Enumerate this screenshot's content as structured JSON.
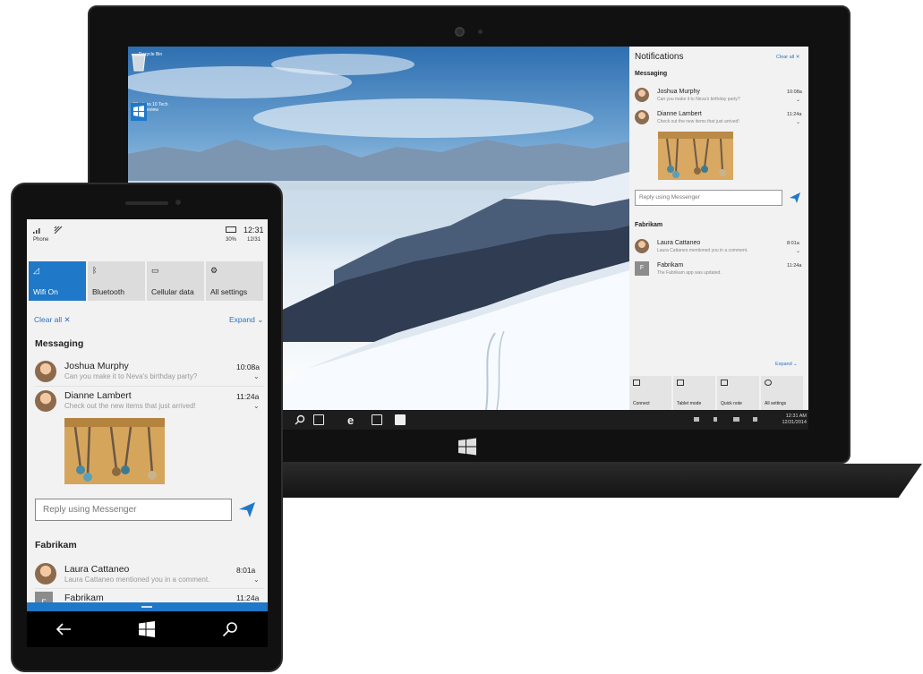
{
  "laptop": {
    "desktop_icons": [
      {
        "label": "Recycle Bin",
        "icon": "recycle-bin-icon"
      },
      {
        "label": "Windows 10 Tech Preview",
        "icon": "windows-logo-icon"
      }
    ],
    "notifications": {
      "title": "Notifications",
      "clear_all": "Clear all ✕",
      "expand": "Expand ⌄",
      "sections": [
        {
          "title": "Messaging",
          "items": [
            {
              "name": "Joshua Murphy",
              "message": "Can you make it to Neva's birthday party?",
              "time": "10:08a"
            },
            {
              "name": "Dianne Lambert",
              "message": "Check out the new items that just arrived!",
              "time": "11:24a"
            }
          ]
        },
        {
          "title": "Fabrikam",
          "items": [
            {
              "name": "Laura Cattaneo",
              "message": "Laura Cattaneo mentioned you in a comment.",
              "time": "8:01a"
            },
            {
              "name": "Fabrikam",
              "message": "The Fabrikam app was updated.",
              "time": "11:24a",
              "initial": "F"
            }
          ]
        }
      ],
      "reply_placeholder": "Reply using Messenger",
      "quick_actions": [
        {
          "label": "Connect",
          "icon": "connect-icon"
        },
        {
          "label": "Tablet mode",
          "icon": "tablet-mode-icon"
        },
        {
          "label": "Quick note",
          "icon": "quick-note-icon"
        },
        {
          "label": "All settings",
          "icon": "gear-icon"
        }
      ]
    },
    "taskbar": {
      "time": "12:31 AM",
      "date": "12/31/2014"
    }
  },
  "phone": {
    "status": {
      "carrier": "Phone",
      "time": "12:31",
      "battery": "30%",
      "date": "12/31"
    },
    "quick_actions": [
      {
        "label": "Wifi On",
        "icon": "wifi-icon",
        "active": true
      },
      {
        "label": "Bluetooth",
        "icon": "bluetooth-icon",
        "active": false
      },
      {
        "label": "Cellular data",
        "icon": "cellular-data-icon",
        "active": false
      },
      {
        "label": "All settings",
        "icon": "gear-icon",
        "active": false
      }
    ],
    "clear_all": "Clear all ✕",
    "expand": "Expand ⌄",
    "sections": [
      {
        "title": "Messaging",
        "items": [
          {
            "name": "Joshua Murphy",
            "message": "Can you make it to Neva's birthday party?",
            "time": "10:08a"
          },
          {
            "name": "Dianne Lambert",
            "message": "Check out the new items that just arrived!",
            "time": "11:24a"
          }
        ]
      },
      {
        "title": "Fabrikam",
        "items": [
          {
            "name": "Laura Cattaneo",
            "message": "Laura Cattaneo mentioned you in a comment.",
            "time": "8:01a"
          },
          {
            "name": "Fabrikam",
            "message": "",
            "time": "11:24a",
            "initial": "F"
          }
        ]
      }
    ],
    "reply_placeholder": "Reply using Messenger"
  },
  "colors": {
    "accent": "#1f78c8",
    "link": "#2a72c4",
    "panel_bg": "#f2f2f2"
  }
}
